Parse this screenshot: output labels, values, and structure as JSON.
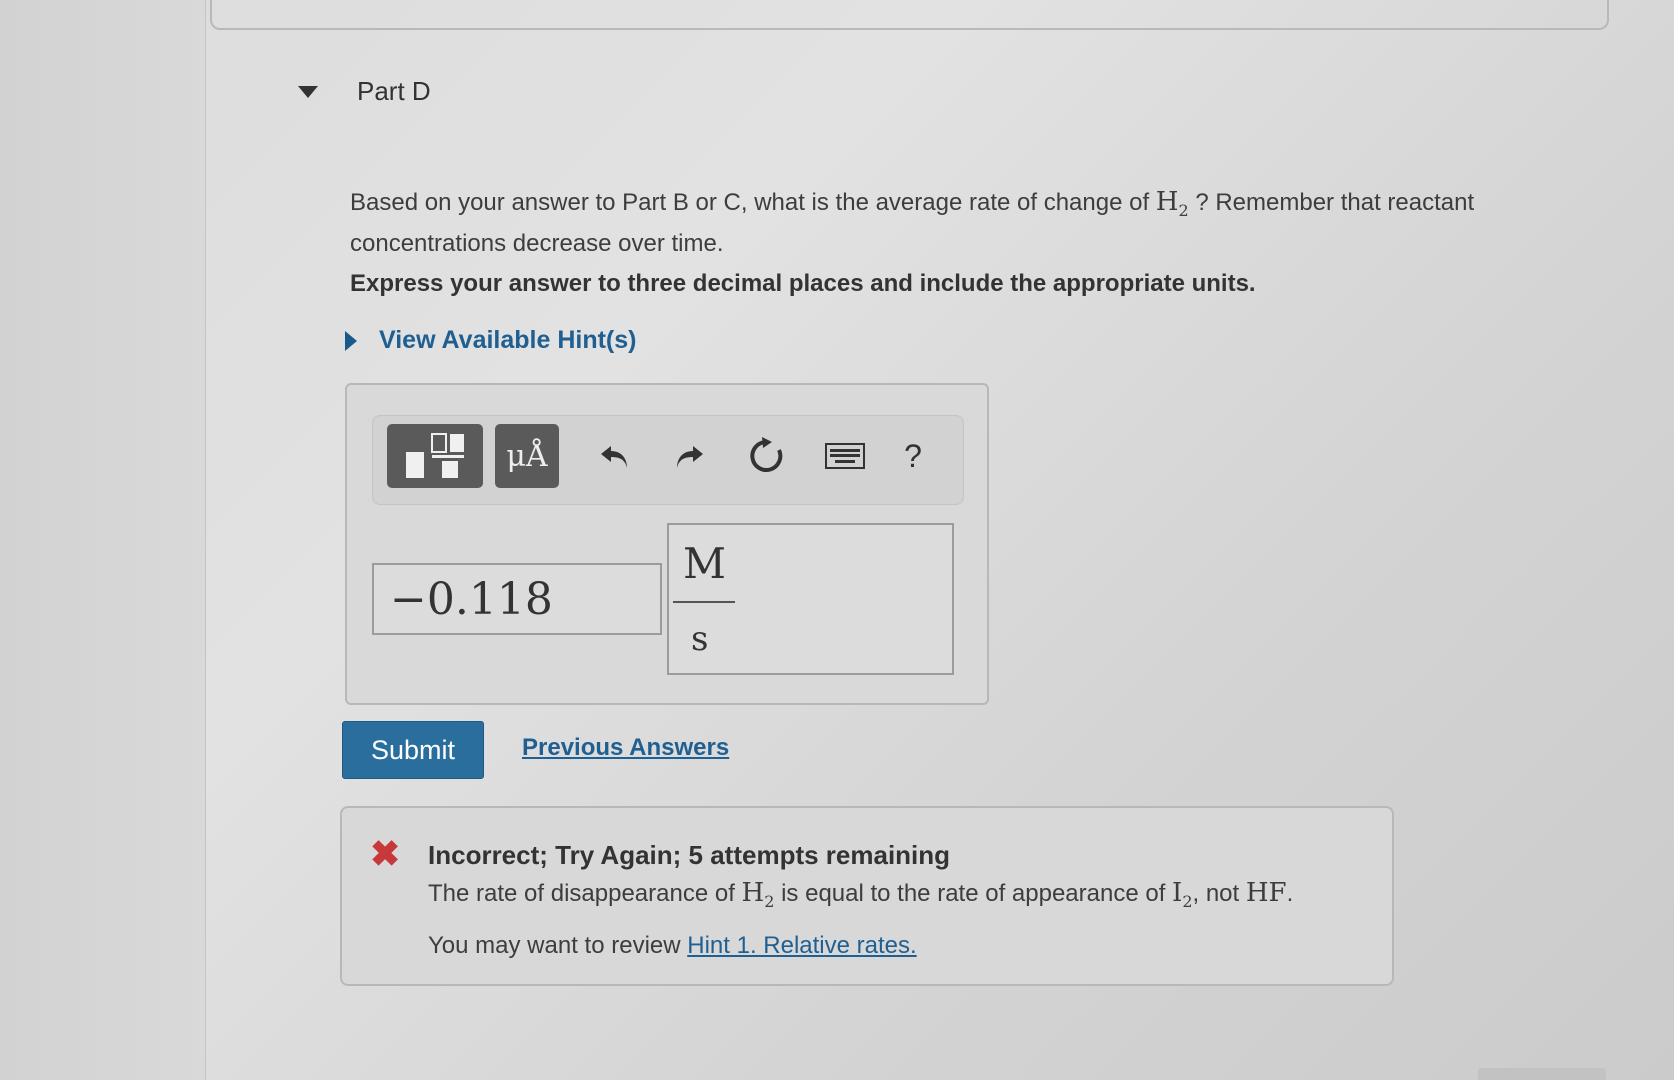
{
  "part": {
    "title": "Part D"
  },
  "question": {
    "text_before": "Based on your answer to Part B or C, what is the average rate of change of ",
    "species": "H",
    "species_sub": "2",
    "text_after": " ? Remember that reactant concentrations decrease over time.",
    "instruction": "Express your answer to three decimal places and include the appropriate units."
  },
  "hints": {
    "label": "View Available Hint(s)"
  },
  "toolbar": {
    "templates_icon": "templates-icon",
    "units_label": "μÅ",
    "undo_icon": "undo-icon",
    "redo_icon": "redo-icon",
    "reset_icon": "reset-icon",
    "keyboard_icon": "keyboard-icon",
    "help_label": "?"
  },
  "answer": {
    "value": "−0.118",
    "unit_numerator": "M",
    "unit_denominator": "s"
  },
  "actions": {
    "submit_label": "Submit",
    "previous_answers_label": "Previous Answers"
  },
  "feedback": {
    "status_icon": "x-icon",
    "title": "Incorrect; Try Again; 5 attempts remaining",
    "detail_1": "The rate of disappearance of ",
    "detail_h": "H",
    "detail_h_sub": "2",
    "detail_2": " is equal to the rate of appearance of ",
    "detail_i": "I",
    "detail_i_sub": "2",
    "detail_3": ", not ",
    "detail_hf": "HF",
    "detail_end": ".",
    "review_prefix": "You may want to review ",
    "review_link": "Hint 1. Relative rates."
  },
  "colors": {
    "link": "#1f5f92",
    "submit_bg": "#2a6e9e",
    "error": "#c8373a",
    "toolbar_button": "#5a5a5a"
  }
}
